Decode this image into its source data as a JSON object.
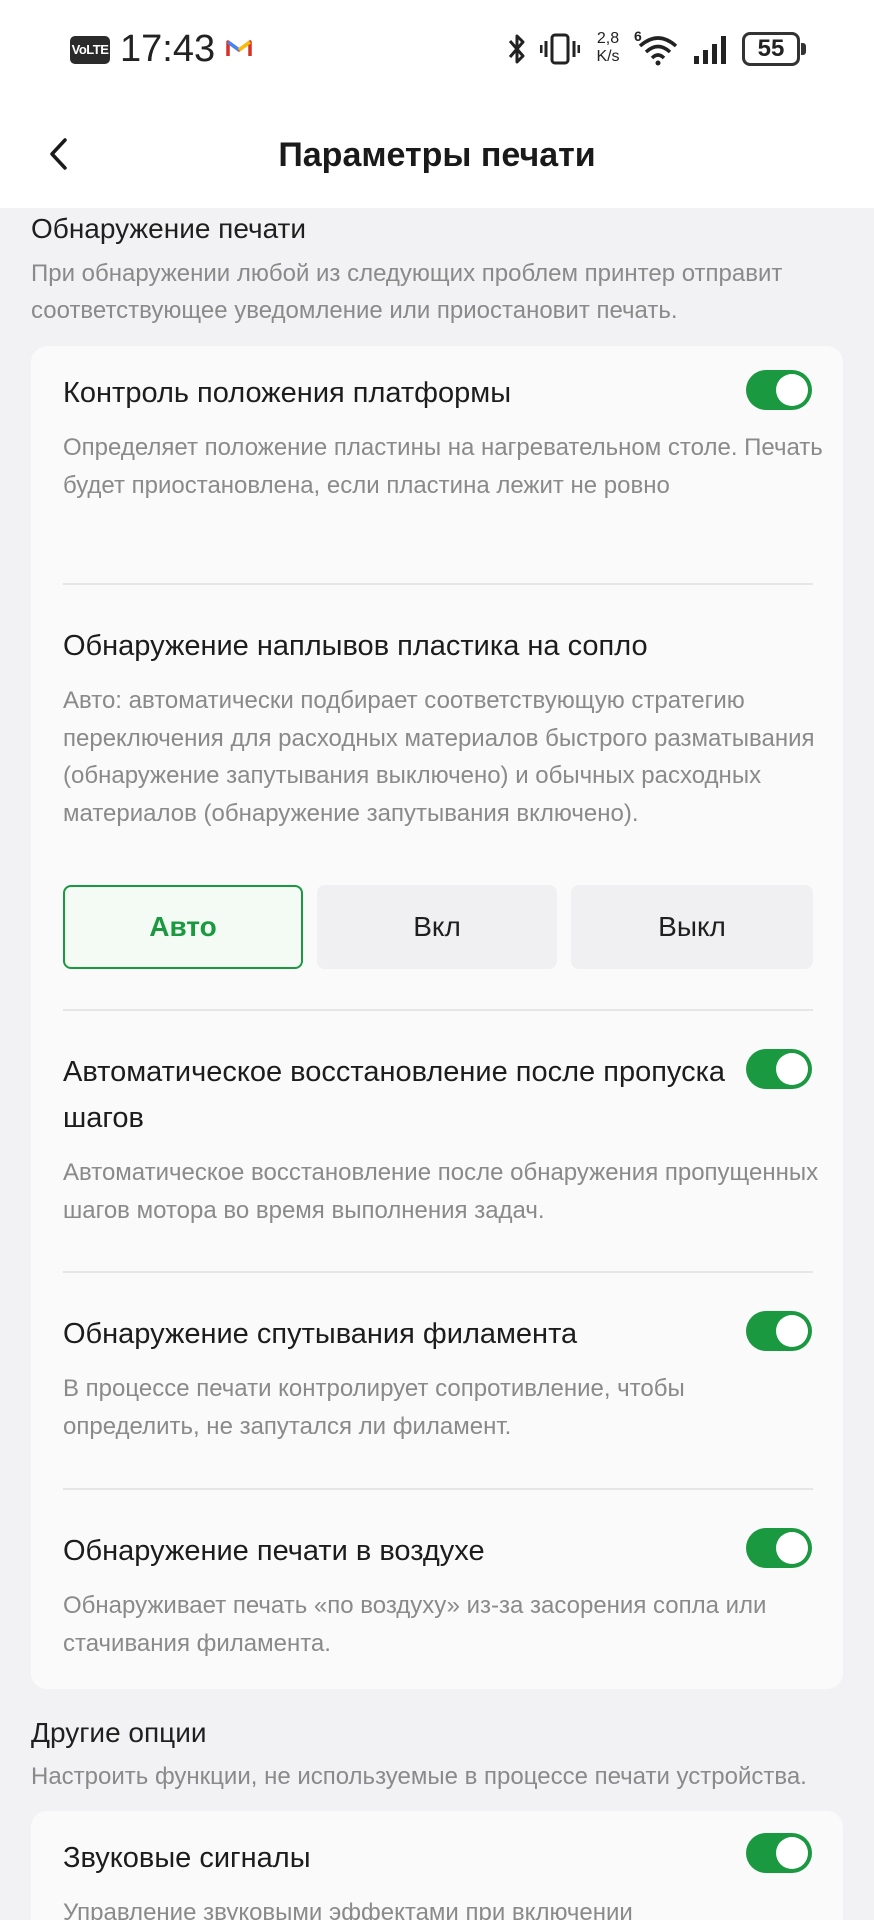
{
  "status_bar": {
    "volte": "VoLTE",
    "time": "17:43",
    "speed_value": "2,8",
    "speed_unit": "K/s",
    "network_badge": "6",
    "battery": "55"
  },
  "header": {
    "title": "Параметры печати"
  },
  "print_detection": {
    "title": "Обнаружение печати",
    "description": "При обнаружении любой из следующих проблем принтер отправит соответствующее уведомление или приостановит печать.",
    "items": [
      {
        "title": "Контроль положения платформы",
        "description": "Определяет положение пластины на нагревательном столе. Печать будет приостановлена, если пластина лежит не ровно",
        "enabled": true
      },
      {
        "title": "Обнаружение наплывов пластика на сопло",
        "description": "Авто: автоматически подбирает соответствующую стратегию переключения для расходных материалов быстрого разматывания (обнаружение запутывания выключено) и обычных расходных материалов (обнаружение запутывания включено).",
        "options": [
          "Авто",
          "Вкл",
          "Выкл"
        ],
        "selected": "Авто"
      },
      {
        "title": "Автоматическое восстановление после пропуска шагов",
        "description": "Автоматическое восстановление после обнаружения пропущенных шагов мотора во время выполнения задач.",
        "enabled": true
      },
      {
        "title": "Обнаружение спутывания филамента",
        "description": "В процессе печати контролирует сопротивление, чтобы определить, не запутался ли филамент.",
        "enabled": true
      },
      {
        "title": "Обнаружение печати в воздухе",
        "description": "Обнаруживает печать «по воздуху» из-за засорения сопла или стачивания филамента.",
        "enabled": true
      }
    ]
  },
  "other_options": {
    "title": "Другие опции",
    "description": "Настроить функции, не используемые в процессе печати устройства.",
    "items": [
      {
        "title": "Звуковые сигналы",
        "description": "Управление звуковыми эффектами при включении",
        "enabled": true
      }
    ]
  },
  "colors": {
    "accent": "#1a9940",
    "background": "#f2f2f4",
    "card": "#fafafb",
    "secondary_text": "#8a8a8a"
  }
}
